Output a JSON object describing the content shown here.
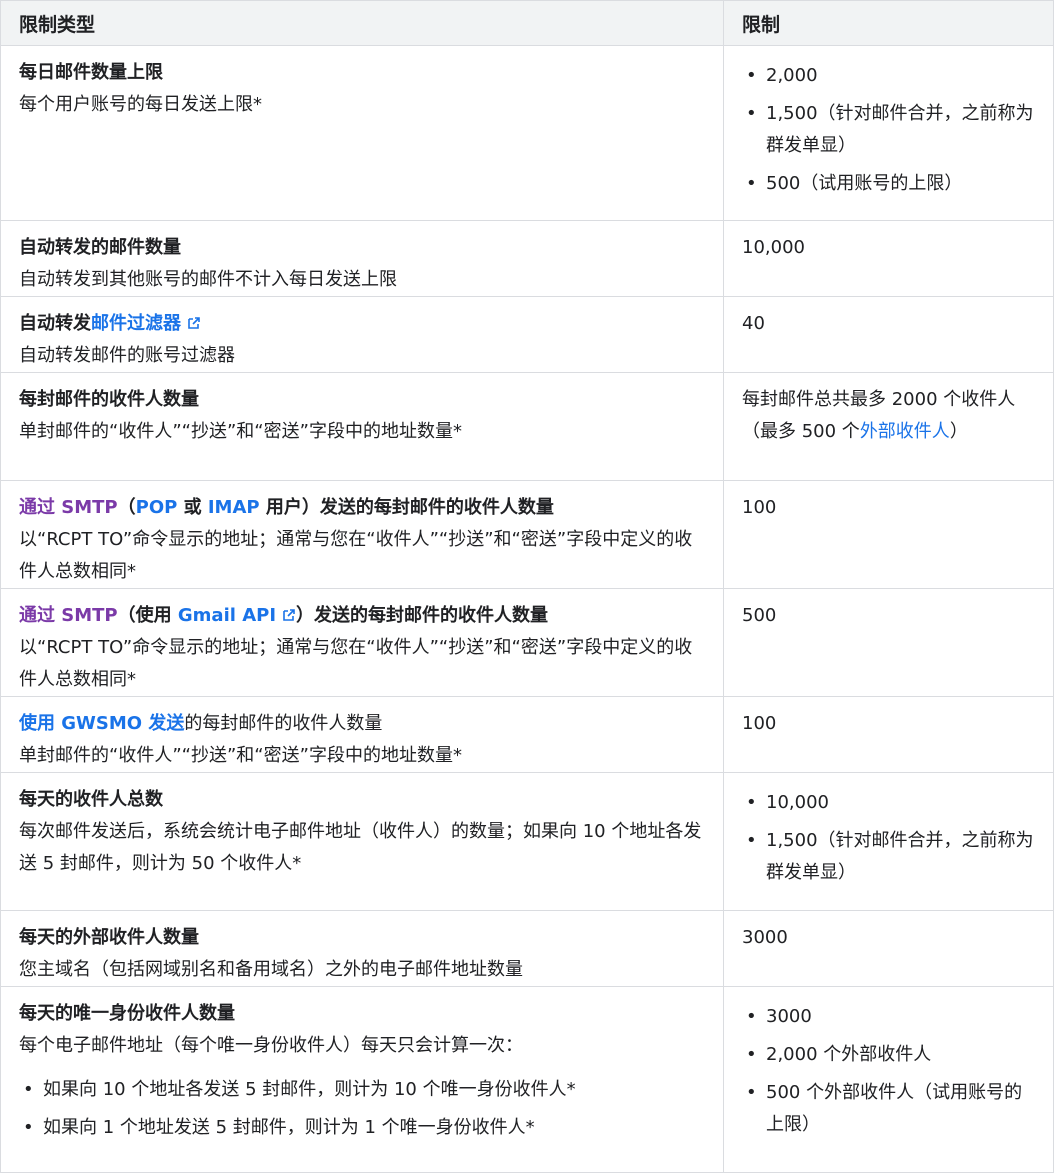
{
  "header": {
    "col1": "限制类型",
    "col2": "限制"
  },
  "rows": [
    {
      "title": "每日邮件数量上限",
      "desc": "每个用户账号的每日发送上限*",
      "limits": [
        "2,000",
        "1,500（针对邮件合并，之前称为群发单显）",
        "500（试用账号的上限）"
      ]
    },
    {
      "title": "自动转发的邮件数量",
      "desc": "自动转发到其他账号的邮件不计入每日发送上限",
      "value": "10,000"
    },
    {
      "title_prefix": "自动转发",
      "title_link": "邮件过滤器",
      "desc": "自动转发邮件的账号过滤器",
      "value": "40"
    },
    {
      "title": "每封邮件的收件人数量",
      "desc": "单封邮件的“收件人”“抄送”和“密送”字段中的地址数量*",
      "value_line1": "每封邮件总共最多 2000 个收件人",
      "value_line2_prefix": "（最多 500 个",
      "value_line2_link": "外部收件人",
      "value_line2_suffix": "）"
    },
    {
      "title_visited": "通过 SMTP",
      "title_mid1": "（",
      "title_link1": "POP",
      "title_mid2": " 或 ",
      "title_link2": "IMAP",
      "title_rest": " 用户）发送的每封邮件的收件人数量",
      "desc": "以“RCPT TO”命令显示的地址；通常与您在“收件人”“抄送”和“密送”字段中定义的收件人总数相同*",
      "value": "100"
    },
    {
      "title_visited": "通过 SMTP",
      "title_mid1": "（使用 ",
      "title_link1": "Gmail API",
      "title_rest": "）发送的每封邮件的收件人数量",
      "desc": "以“RCPT TO”命令显示的地址；通常与您在“收件人”“抄送”和“密送”字段中定义的收件人总数相同*",
      "value": "500"
    },
    {
      "title_link": "使用 GWSMO 发送",
      "title_rest": "的每封邮件的收件人数量",
      "desc": "单封邮件的“收件人”“抄送”和“密送”字段中的地址数量*",
      "value": "100"
    },
    {
      "title": "每天的收件人总数",
      "desc": "每次邮件发送后，系统会统计电子邮件地址（收件人）的数量；如果向 10 个地址各发送 5 封邮件，则计为 50 个收件人*",
      "limits": [
        "10,000",
        "1,500（针对邮件合并，之前称为群发单显）"
      ]
    },
    {
      "title": "每天的外部收件人数量",
      "desc": "您主域名（包括网域别名和备用域名）之外的电子邮件地址数量",
      "value": "3000"
    },
    {
      "title": "每天的唯一身份收件人数量",
      "desc": "每个电子邮件地址（每个唯一身份收件人）每天只会计算一次：",
      "sub": [
        "如果向 10 个地址各发送 5 封邮件，则计为 10 个唯一身份收件人*",
        "如果向 1 个地址发送 5 封邮件，则计为 1 个唯一身份收件人*"
      ],
      "limits": [
        "3000",
        "2,000 个外部收件人",
        "500 个外部收件人（试用账号的上限）"
      ]
    }
  ]
}
